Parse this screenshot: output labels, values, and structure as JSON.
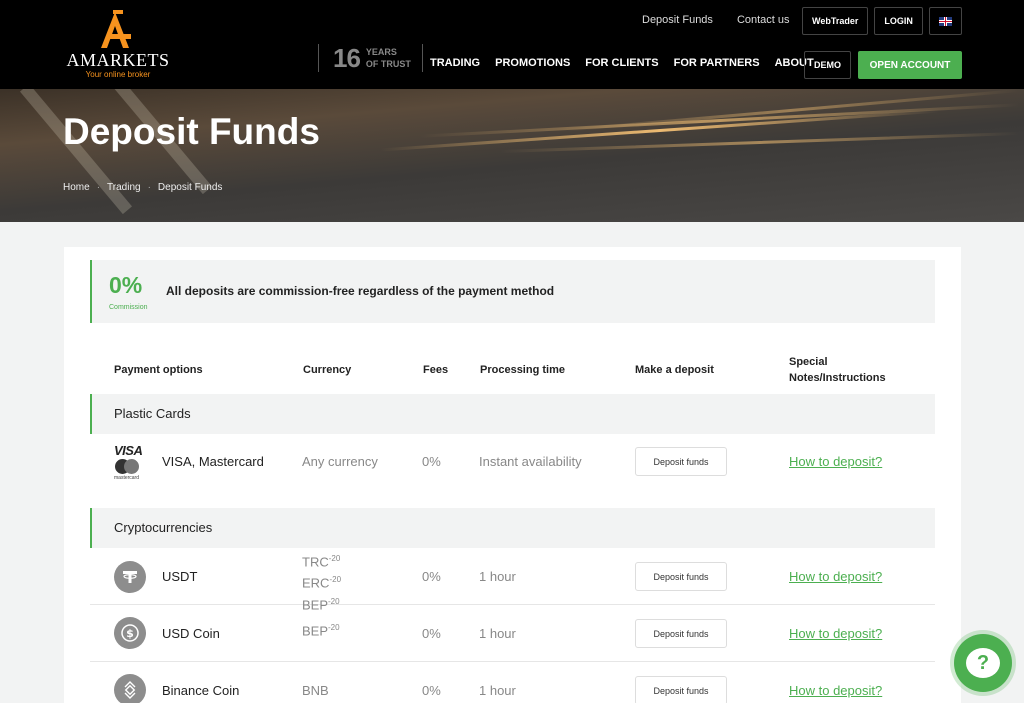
{
  "brand": {
    "name": "AMARKETS",
    "tagline": "Your online broker",
    "accent": "#f7931e"
  },
  "top_links": {
    "deposit": "Deposit Funds",
    "contact": "Contact us",
    "webtrader": "WebTrader",
    "login": "LOGIN"
  },
  "years": {
    "number": "16",
    "line1": "YEARS",
    "line2": "OF TRUST"
  },
  "nav": [
    "TRADING",
    "PROMOTIONS",
    "FOR CLIENTS",
    "FOR PARTNERS",
    "ABOUT"
  ],
  "buttons": {
    "demo": "DEMO",
    "open_account": "OPEN ACCOUNT",
    "open_color": "#4caf50"
  },
  "hero": {
    "title": "Deposit Funds",
    "breadcrumb": [
      "Home",
      "Trading",
      "Deposit Funds"
    ]
  },
  "banner": {
    "value": "0%",
    "label": "Commission",
    "text": "All deposits are commission-free regardless of the payment method"
  },
  "columns": [
    "Payment options",
    "Currency",
    "Fees",
    "Processing time",
    "Make a deposit",
    "Special Notes/Instructions"
  ],
  "sections": {
    "cards": "Plastic Cards",
    "crypto": "Cryptocurrencies"
  },
  "card_row": {
    "name": "VISA, Mastercard",
    "logo_visa": "VISA",
    "logo_mc": "mastercard",
    "currency": "Any currency",
    "fees": "0%",
    "time": "Instant availability",
    "deposit": "Deposit funds",
    "how": "How to deposit?"
  },
  "crypto_rows": [
    {
      "icon": "tether-icon",
      "name": "USDT",
      "currency_lines": [
        "TRC",
        "ERC",
        "BEP"
      ],
      "sup": "-20",
      "fees": "0%",
      "time": "1 hour",
      "deposit": "Deposit funds",
      "how": "How to deposit?"
    },
    {
      "icon": "usd-coin-icon",
      "name": "USD Coin",
      "currency_lines": [
        "BEP"
      ],
      "sup": "-20",
      "fees": "0%",
      "time": "1 hour",
      "deposit": "Deposit funds",
      "how": "How to deposit?"
    },
    {
      "icon": "binance-coin-icon",
      "name": "Binance Coin",
      "currency": "BNB",
      "fees": "0%",
      "time": "1 hour",
      "deposit": "Deposit funds",
      "how": "How to deposit?"
    }
  ],
  "chat_icon": "chat-help-icon"
}
